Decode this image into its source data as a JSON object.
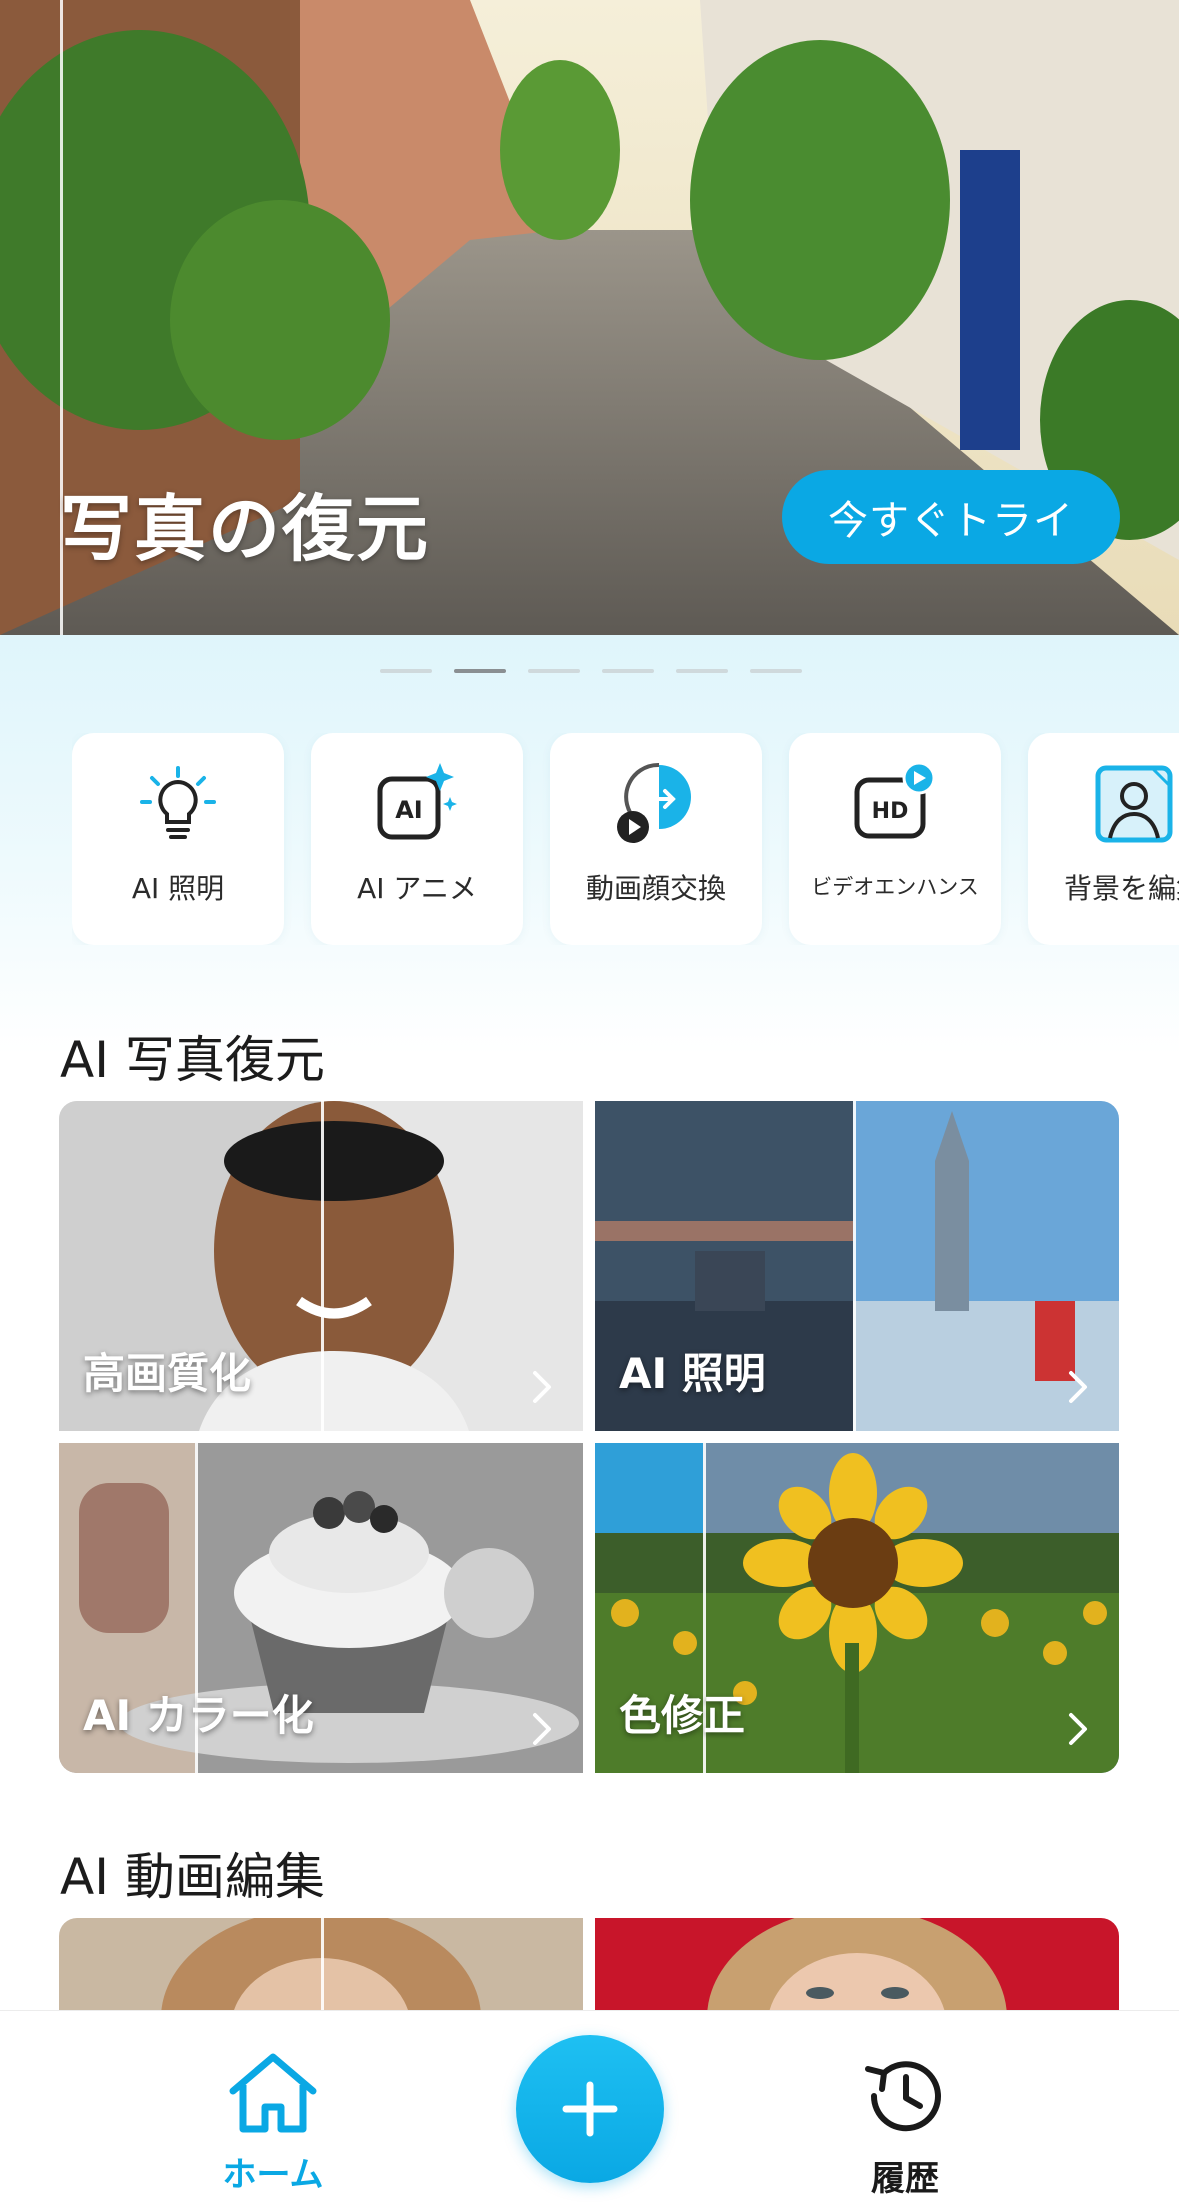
{
  "hero": {
    "title": "写真の復元",
    "cta_label": "今すぐトライ",
    "pager_count": 6,
    "pager_active_index": 1
  },
  "tools": [
    {
      "label": "AI 照明",
      "icon": "lightbulb-icon"
    },
    {
      "label": "AI アニメ",
      "icon": "ai-sparkle-icon"
    },
    {
      "label": "動画顔交換",
      "icon": "face-swap-icon"
    },
    {
      "label": "ビデオエンハンス",
      "icon": "hd-video-icon"
    },
    {
      "label": "背景を編集",
      "icon": "background-edit-icon"
    }
  ],
  "photo_section": {
    "title": "AI 写真復元",
    "cards": [
      {
        "label": "高画質化"
      },
      {
        "label": "AI 照明"
      },
      {
        "label": "AI カラー化"
      },
      {
        "label": "色修正"
      }
    ]
  },
  "video_section": {
    "title": "AI 動画編集"
  },
  "nav": {
    "home_label": "ホーム",
    "history_label": "履歴",
    "add_icon": "plus-icon"
  },
  "colors": {
    "accent": "#0aa8e4",
    "tile_bg": "#ffffff",
    "panel_bg": "#dff5fb"
  }
}
